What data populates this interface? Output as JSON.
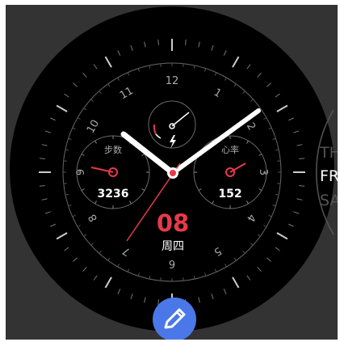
{
  "watch_face": {
    "hour_numerals": [
      "12",
      "1",
      "2",
      "3",
      "4",
      "5",
      "6",
      "7",
      "8",
      "9",
      "10",
      "11"
    ],
    "left_subdial": {
      "label": "步数",
      "value": "3236"
    },
    "right_subdial": {
      "label": "心率",
      "value": "152"
    },
    "top_subdial": {
      "icon": "lightning-bolt-icon"
    },
    "date": {
      "day": "08",
      "weekday": "周四"
    },
    "time": {
      "hour_hand_points_to": "10:10",
      "minute_hand_points_to": "10:10"
    }
  },
  "day_picker": {
    "prev": "TH",
    "current": "FR",
    "next": "SA"
  },
  "edit_button": {
    "icon": "pencil-icon"
  },
  "colors": {
    "accent_red": "#e8394a",
    "hand_white": "#ffffff",
    "edit_blue": "#4a78e8",
    "background": "#333333",
    "dial": "#000000"
  }
}
